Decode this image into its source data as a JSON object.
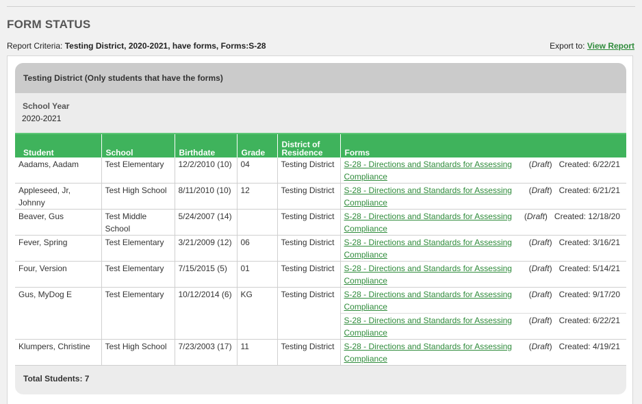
{
  "page": {
    "title": "FORM STATUS",
    "criteria_label": "Report Criteria: ",
    "criteria_value": "Testing District, 2020-2021, have forms, Forms:S-28",
    "export_label": "Export to: ",
    "export_link": "View Report"
  },
  "report": {
    "header": "Testing District (Only students that have the forms)",
    "school_year_label": "School Year",
    "school_year": "2020-2021",
    "columns": [
      "Student",
      "School",
      "Birthdate",
      "Grade",
      "District of Residence",
      "Forms"
    ],
    "rows": [
      {
        "student": "Aadams, Aadam",
        "school": "Test Elementary",
        "birthdate": "12/2/2010 (10)",
        "grade": "04",
        "district": "Testing District",
        "forms": [
          {
            "name": "S-28 - Directions and Standards for Assessing Compliance",
            "status": "Draft",
            "created": "Created: 6/22/21"
          }
        ]
      },
      {
        "student": "Appleseed, Jr, Johnny",
        "school": "Test High School",
        "birthdate": "8/11/2010 (10)",
        "grade": "12",
        "district": "Testing District",
        "forms": [
          {
            "name": "S-28 - Directions and Standards for Assessing Compliance",
            "status": "Draft",
            "created": "Created: 6/21/21"
          }
        ]
      },
      {
        "student": "Beaver, Gus",
        "school": "Test Middle School",
        "birthdate": "5/24/2007 (14)",
        "grade": "",
        "district": "Testing District",
        "forms": [
          {
            "name": "S-28 - Directions and Standards for Assessing Compliance",
            "status": "Draft",
            "created": "Created: 12/18/20"
          }
        ]
      },
      {
        "student": "Fever, Spring",
        "school": "Test Elementary",
        "birthdate": "3/21/2009 (12)",
        "grade": "06",
        "district": "Testing District",
        "forms": [
          {
            "name": "S-28 - Directions and Standards for Assessing Compliance",
            "status": "Draft",
            "created": "Created: 3/16/21"
          }
        ]
      },
      {
        "student": "Four, Version",
        "school": "Test Elementary",
        "birthdate": "7/15/2015 (5)",
        "grade": "01",
        "district": "Testing District",
        "forms": [
          {
            "name": "S-28 - Directions and Standards for Assessing Compliance",
            "status": "Draft",
            "created": "Created: 5/14/21"
          }
        ]
      },
      {
        "student": "Gus, MyDog E",
        "school": "Test Elementary",
        "birthdate": "10/12/2014 (6)",
        "grade": "KG",
        "district": "Testing District",
        "forms": [
          {
            "name": "S-28 - Directions and Standards for Assessing Compliance",
            "status": "Draft",
            "created": "Created: 9/17/20"
          },
          {
            "name": "S-28 - Directions and Standards for Assessing Compliance",
            "status": "Draft",
            "created": "Created: 6/22/21"
          }
        ]
      },
      {
        "student": "Klumpers, Christine",
        "school": "Test High School",
        "birthdate": "7/23/2003 (17)",
        "grade": "11",
        "district": "Testing District",
        "forms": [
          {
            "name": "S-28 - Directions and Standards for Assessing Compliance",
            "status": "Draft",
            "created": "Created: 4/19/21"
          }
        ]
      }
    ],
    "total": "Total Students: 7"
  },
  "colors": {
    "header_green": "#3fb35c",
    "link_green": "#2e8b3a"
  }
}
